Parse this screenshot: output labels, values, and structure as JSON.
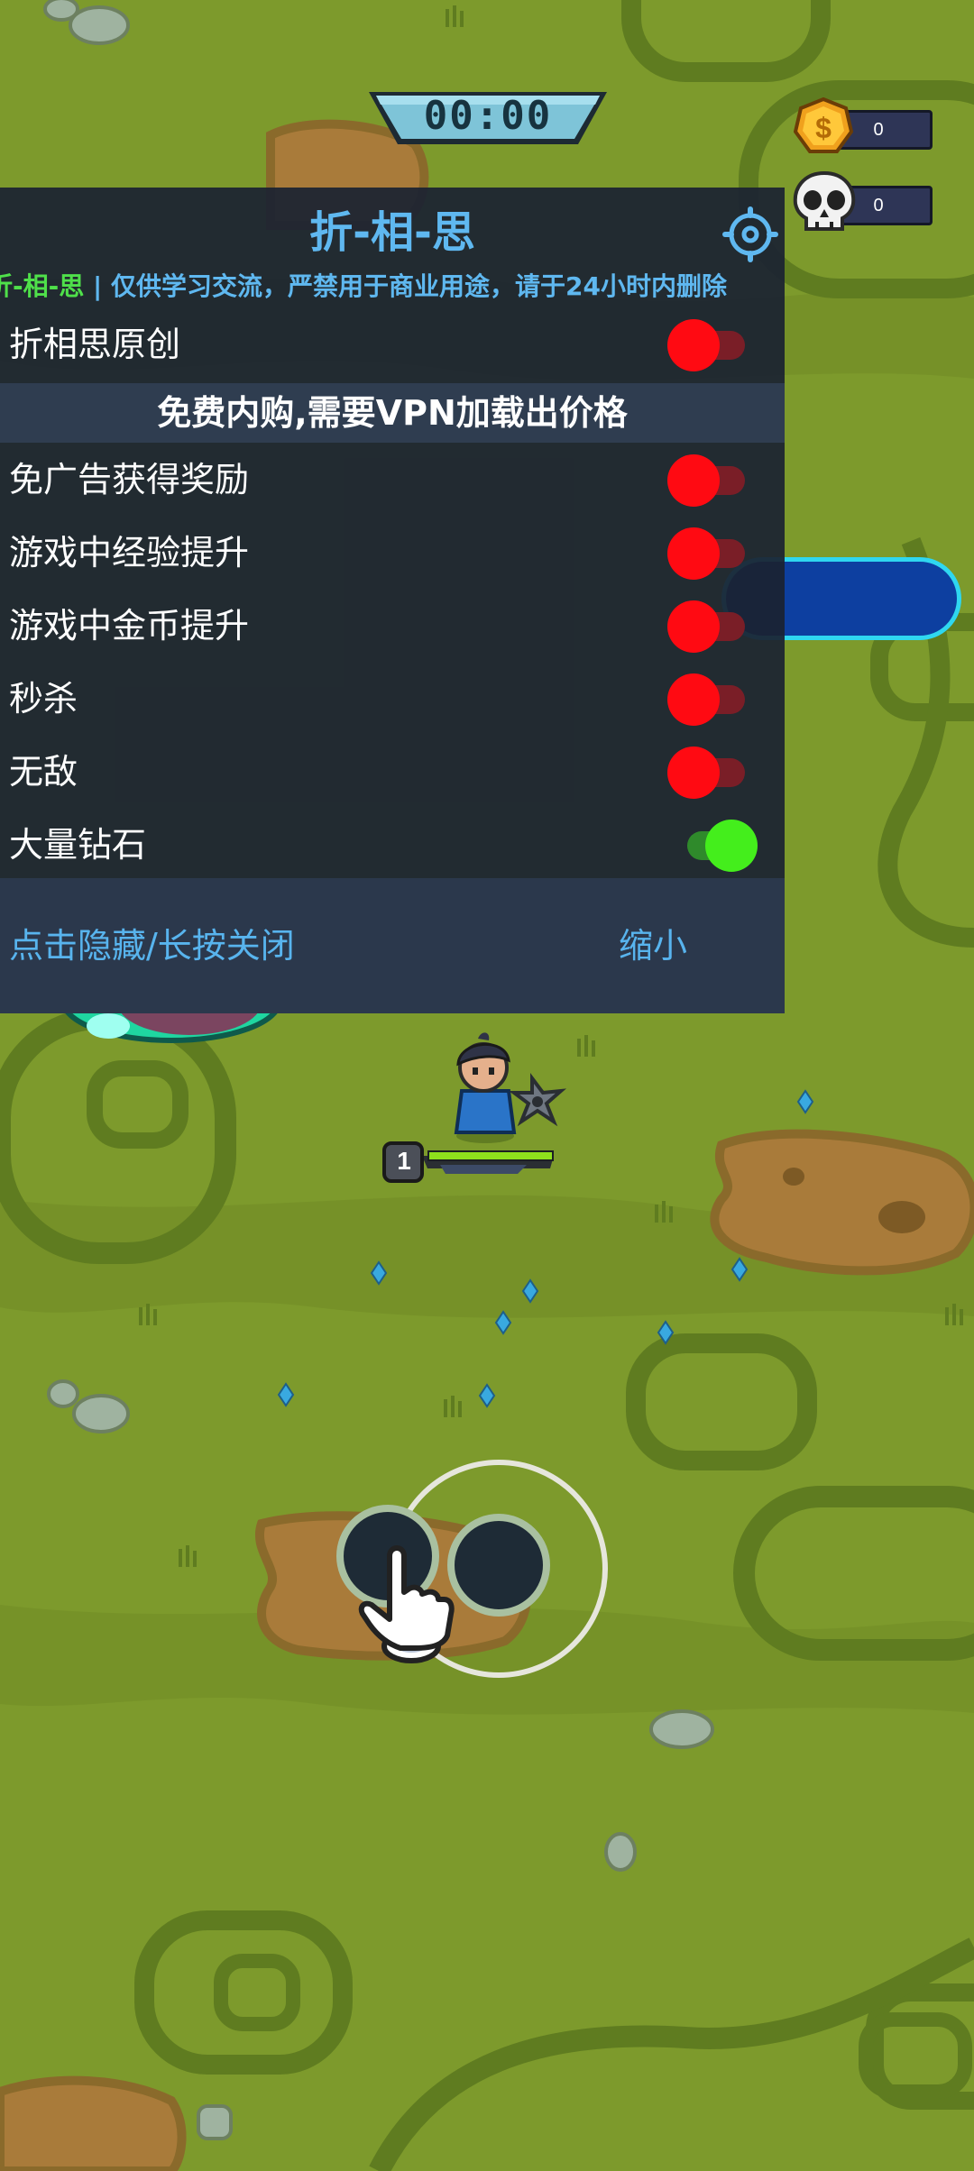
{
  "hud": {
    "timer": "00:00",
    "coins": "0",
    "kills": "0",
    "level": "1"
  },
  "menu": {
    "title": "折-相-思",
    "marquee_brand": "折-相-思",
    "marquee_text": " | 仅供学习交流，严禁用于商业用途，请于24小时内删除",
    "section_title": "免费内购,需要VPN加载出价格",
    "items": [
      {
        "label": "折相思原创",
        "state": "off"
      },
      {
        "label": "免广告获得奖励",
        "state": "off"
      },
      {
        "label": "游戏中经验提升",
        "state": "off"
      },
      {
        "label": "游戏中金币提升",
        "state": "off"
      },
      {
        "label": "秒杀",
        "state": "off"
      },
      {
        "label": "无敌",
        "state": "off"
      },
      {
        "label": "大量钻石",
        "state": "on"
      }
    ],
    "footer_left": "点击隐藏/长按关闭",
    "footer_right": "缩小"
  },
  "colors": {
    "grass": "#7d9a2c",
    "menu_bg": "#1b2231",
    "accent_blue": "#5fb8f0",
    "brand_green": "#4fe04a",
    "toggle_off": "#ff0a12",
    "toggle_on": "#44ee1c"
  },
  "icons": {
    "settings": "gear-icon",
    "coin": "coin-icon",
    "kills": "skull-icon",
    "joystick_hand": "pointing-hand-icon"
  }
}
